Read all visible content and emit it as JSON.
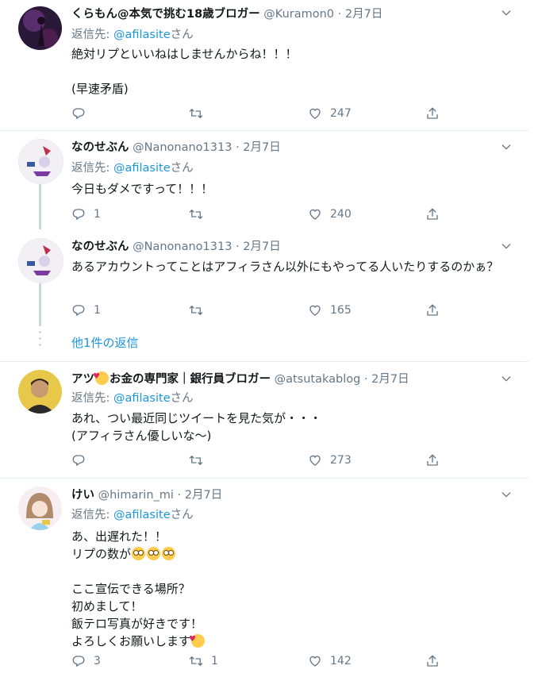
{
  "tweets": [
    {
      "name": "くらもん@本気で挑む18歳ブロガー",
      "handle": "@Kuramon0",
      "sep": "·",
      "date": "2月7日",
      "reply_label": "返信先:",
      "reply_mention": "@afilasite",
      "reply_suffix": "さん",
      "text": "絶対リプといいねはしませんからね！！！\n\n(早速矛盾)",
      "replies": "",
      "retweets": "",
      "likes": "247"
    },
    {
      "name": "なのせぶん",
      "handle": "@Nanonano1313",
      "sep": "·",
      "date": "2月7日",
      "reply_label": "返信先:",
      "reply_mention": "@afilasite",
      "reply_suffix": "さん",
      "text": "今日もダメですって！！！",
      "replies": "1",
      "retweets": "",
      "likes": "240"
    },
    {
      "name": "なのせぶん",
      "handle": "@Nanonano1313",
      "sep": "·",
      "date": "2月7日",
      "text": "あるアカウントってことはアフィラさん以外にもやってる人いたりするのかぁ？",
      "replies": "1",
      "retweets": "",
      "likes": "165",
      "more_replies": "他1件の返信"
    },
    {
      "name": "アツ",
      "name_rest": "お金の専門家｜銀行員ブロガー",
      "handle": "@atsutakablog",
      "sep": "·",
      "date": "2月7日",
      "reply_label": "返信先:",
      "reply_mention": "@afilasite",
      "reply_suffix": "さん",
      "text": "あれ、つい最近同じツイートを見た気が・・・\n(アフィラさん優しいな〜)",
      "replies": "",
      "retweets": "",
      "likes": "273"
    },
    {
      "name": "けい",
      "handle": "@himarin_mi",
      "sep": "·",
      "date": "2月7日",
      "reply_label": "返信先:",
      "reply_mention": "@afilasite",
      "reply_suffix": "さん",
      "text_line1": "あ、出遅れた！！",
      "text_line2": "リプの数が",
      "text_line3": "ここ宣伝できる場所？\n初めまして！\n飯テロ写真が好きです！",
      "text_line4": "よろしくお願いします",
      "replies": "3",
      "retweets": "1",
      "likes": "142"
    }
  ],
  "colors": {
    "link": "#1b95e0",
    "muted": "#657786",
    "border": "#e6ecf0"
  },
  "icons": [
    "reply-icon",
    "retweet-icon",
    "like-icon",
    "share-icon",
    "chevron-down-icon"
  ]
}
